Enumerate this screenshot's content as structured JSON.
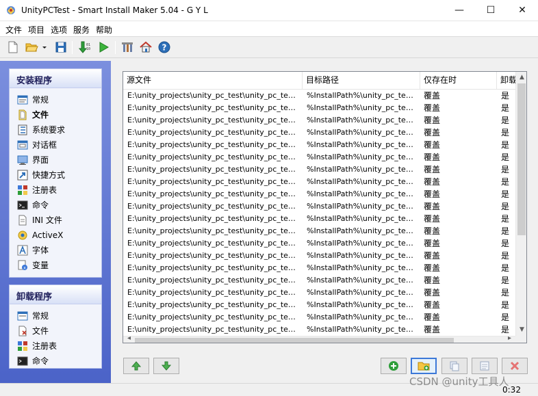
{
  "window": {
    "title": "UnityPCTest - Smart Install Maker 5.04 - G Y L",
    "minimize_glyph": "—",
    "maximize_glyph": "☐",
    "close_glyph": "✕"
  },
  "menu": [
    "文件",
    "项目",
    "选项",
    "服务",
    "帮助"
  ],
  "toolbar": {
    "icons": [
      "new-file-icon",
      "open-folder-icon",
      "dropdown-arrow-icon",
      "save-icon",
      "compile-icon",
      "run-icon",
      "settings-icon",
      "home-icon",
      "help-icon"
    ]
  },
  "sidebar": {
    "install": {
      "title": "安装程序",
      "items": [
        {
          "label": "常规",
          "icon": "general-icon"
        },
        {
          "label": "文件",
          "icon": "files-icon",
          "active": true
        },
        {
          "label": "系统要求",
          "icon": "requirements-icon"
        },
        {
          "label": "对话框",
          "icon": "dialog-icon"
        },
        {
          "label": "界面",
          "icon": "interface-icon"
        },
        {
          "label": "快捷方式",
          "icon": "shortcut-icon"
        },
        {
          "label": "注册表",
          "icon": "registry-icon"
        },
        {
          "label": "命令",
          "icon": "command-icon"
        },
        {
          "label": "INI 文件",
          "icon": "ini-file-icon"
        },
        {
          "label": "ActiveX",
          "icon": "activex-icon"
        },
        {
          "label": "字体",
          "icon": "font-icon"
        },
        {
          "label": "变量",
          "icon": "variable-icon"
        }
      ]
    },
    "uninstall": {
      "title": "卸载程序",
      "items": [
        {
          "label": "常规",
          "icon": "general-icon"
        },
        {
          "label": "文件",
          "icon": "files-icon"
        },
        {
          "label": "注册表",
          "icon": "registry-icon"
        },
        {
          "label": "命令",
          "icon": "command-icon"
        }
      ]
    }
  },
  "table": {
    "columns": [
      "源文件",
      "目标路径",
      "仅存在时",
      "卸载"
    ],
    "rows": [
      [
        "E:\\unity_projects\\unity_pc_test\\unity_pc_test.exe",
        "%InstallPath%\\unity_pc_test....",
        "覆盖",
        "是"
      ],
      [
        "E:\\unity_projects\\unity_pc_test\\unity_pc_test_D...",
        "%InstallPath%\\unity_pc_test...",
        "覆盖",
        "是"
      ],
      [
        "E:\\unity_projects\\unity_pc_test\\unity_pc_test_D...",
        "%InstallPath%\\unity_pc_test...",
        "覆盖",
        "是"
      ],
      [
        "E:\\unity_projects\\unity_pc_test\\unity_pc_test_D...",
        "%InstallPath%\\unity_pc_test...",
        "覆盖",
        "是"
      ],
      [
        "E:\\unity_projects\\unity_pc_test\\unity_pc_test_D...",
        "%InstallPath%\\unity_pc_test...",
        "覆盖",
        "是"
      ],
      [
        "E:\\unity_projects\\unity_pc_test\\unity_pc_test_D...",
        "%InstallPath%\\unity_pc_test...",
        "覆盖",
        "是"
      ],
      [
        "E:\\unity_projects\\unity_pc_test\\unity_pc_test_D...",
        "%InstallPath%\\unity_pc_test...",
        "覆盖",
        "是"
      ],
      [
        "E:\\unity_projects\\unity_pc_test\\unity_pc_test_D...",
        "%InstallPath%\\unity_pc_test...",
        "覆盖",
        "是"
      ],
      [
        "E:\\unity_projects\\unity_pc_test\\unity_pc_test_D...",
        "%InstallPath%\\unity_pc_test...",
        "覆盖",
        "是"
      ],
      [
        "E:\\unity_projects\\unity_pc_test\\unity_pc_test_D...",
        "%InstallPath%\\unity_pc_test...",
        "覆盖",
        "是"
      ],
      [
        "E:\\unity_projects\\unity_pc_test\\unity_pc_test_D...",
        "%InstallPath%\\unity_pc_test...",
        "覆盖",
        "是"
      ],
      [
        "E:\\unity_projects\\unity_pc_test\\unity_pc_test_D...",
        "%InstallPath%\\unity_pc_test...",
        "覆盖",
        "是"
      ],
      [
        "E:\\unity_projects\\unity_pc_test\\unity_pc_test_D...",
        "%InstallPath%\\unity_pc_test...",
        "覆盖",
        "是"
      ],
      [
        "E:\\unity_projects\\unity_pc_test\\unity_pc_test_D...",
        "%InstallPath%\\unity_pc_test...",
        "覆盖",
        "是"
      ],
      [
        "E:\\unity_projects\\unity_pc_test\\unity_pc_test_D...",
        "%InstallPath%\\unity_pc_test...",
        "覆盖",
        "是"
      ],
      [
        "E:\\unity_projects\\unity_pc_test\\unity_pc_test_D...",
        "%InstallPath%\\unity_pc_test...",
        "覆盖",
        "是"
      ],
      [
        "E:\\unity_projects\\unity_pc_test\\unity_pc_test_D...",
        "%InstallPath%\\unity_pc_test...",
        "覆盖",
        "是"
      ],
      [
        "E:\\unity_projects\\unity_pc_test\\unity_pc_test_D...",
        "%InstallPath%\\unity_pc_test...",
        "覆盖",
        "是"
      ],
      [
        "E:\\unity_projects\\unity_pc_test\\unity_pc_test_D...",
        "%InstallPath%\\unity_pc_test...",
        "覆盖",
        "是"
      ],
      [
        "E:\\unity_projects\\unity_pc_test\\unity_pc_test_D...",
        "%InstallPath%\\unity_pc_test...",
        "覆盖",
        "是"
      ]
    ]
  },
  "actions": {
    "left": [
      "move-up-icon",
      "move-down-icon"
    ],
    "right": [
      "add-icon",
      "add-folder-icon",
      "copy-icon",
      "properties-icon",
      "delete-icon"
    ]
  },
  "status": {
    "time": "0:32"
  },
  "watermark": "CSDN @unity工具人",
  "colors": {
    "sidebar_top": "#7b8fde",
    "sidebar_bottom": "#4b63c8",
    "accent": "#3c78d8"
  }
}
